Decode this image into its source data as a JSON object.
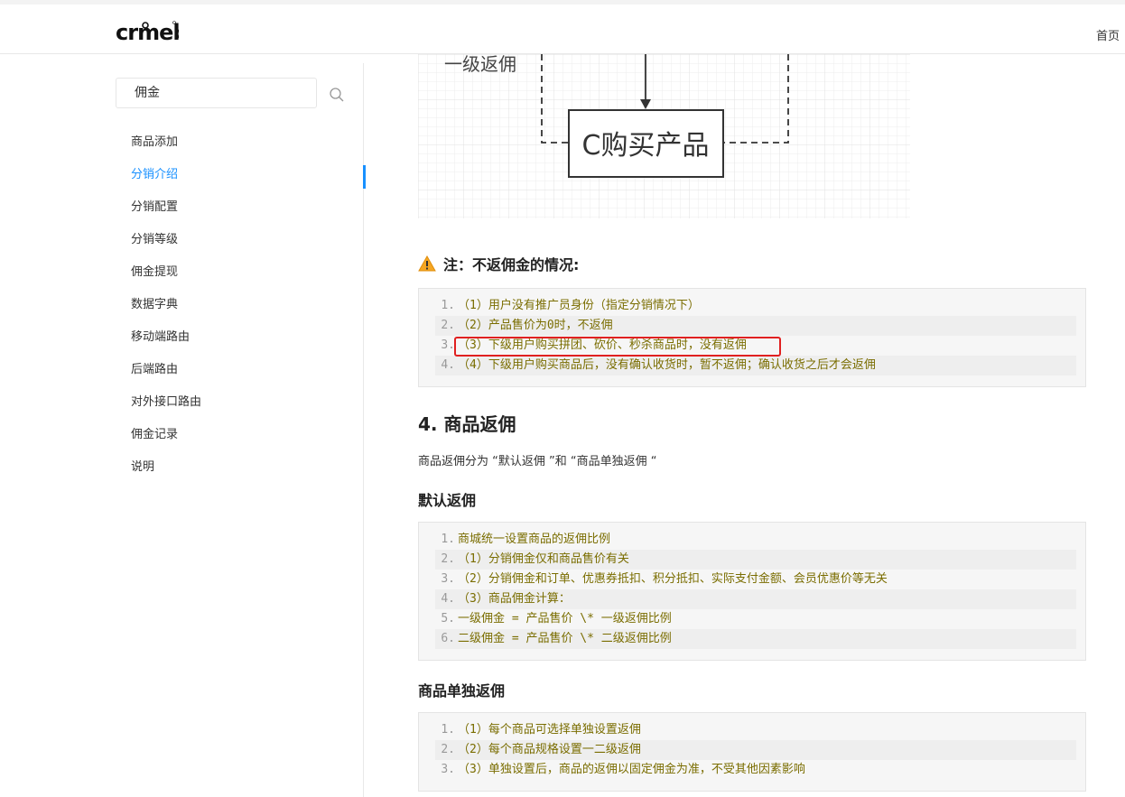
{
  "header": {
    "logo_text": "crmeb",
    "nav_home": "首页"
  },
  "sidebar": {
    "search_value": "佣金",
    "items": [
      {
        "label": "商品添加"
      },
      {
        "label": "分销介绍",
        "active": true
      },
      {
        "label": "分销配置"
      },
      {
        "label": "分销等级"
      },
      {
        "label": "佣金提现"
      },
      {
        "label": "数据字典"
      },
      {
        "label": "移动端路由"
      },
      {
        "label": "后端路由"
      },
      {
        "label": "对外接口路由"
      },
      {
        "label": "佣金记录"
      },
      {
        "label": "说明"
      }
    ]
  },
  "diagram": {
    "left_label": "一级返佣",
    "box_label": "C购买产品"
  },
  "note": {
    "title": "注：不返佣金的情况:"
  },
  "code1": {
    "lines": [
      "（1）用户没有推广员身份（指定分销情况下）",
      "（2）产品售价为0时，不返佣",
      "（3）下级用户购买拼团、砍价、秒杀商品时，没有返佣",
      "（4）下级用户购买商品后，没有确认收货时，暂不返佣；确认收货之后才会返佣"
    ]
  },
  "section4": {
    "title": "4. 商品返佣",
    "desc": "商品返佣分为 “默认返佣 ”和 “商品单独返佣 “"
  },
  "default_rebate": {
    "title": "默认返佣",
    "lines": [
      "商城统一设置商品的返佣比例",
      "（1）分销佣金仅和商品售价有关",
      "（2）分销佣金和订单、优惠券抵扣、积分抵扣、实际支付金额、会员优惠价等无关",
      "（3）商品佣金计算：",
      "一级佣金 = 产品售价 \\* 一级返佣比例",
      "二级佣金 = 产品售价 \\* 二级返佣比例"
    ]
  },
  "single_rebate": {
    "title": "商品单独返佣",
    "lines": [
      "（1）每个商品可选择单独设置返佣",
      "（2）每个商品规格设置一二级返佣",
      "（3）单独设置后，商品的返佣以固定佣金为准，不受其他因素影响"
    ]
  },
  "colors": {
    "accent": "#1890ff",
    "highlight": "#e02020",
    "code_text": "#7a6d00"
  }
}
